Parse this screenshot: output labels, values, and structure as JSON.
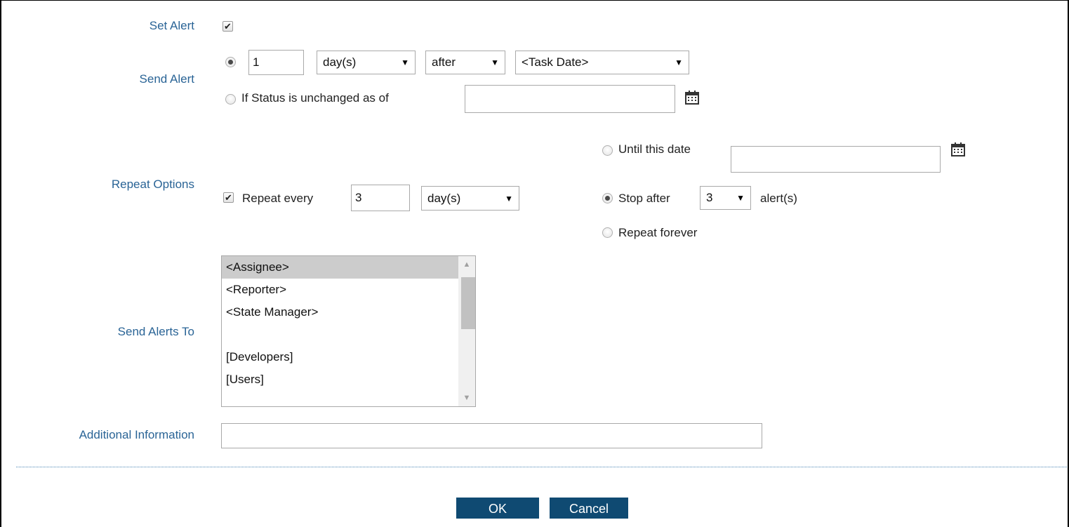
{
  "labels": {
    "set_alert": "Set Alert",
    "send_alert": "Send Alert",
    "repeat_options": "Repeat Options",
    "send_alerts_to": "Send Alerts To",
    "additional_information": "Additional Information"
  },
  "set_alert": {
    "checked": true
  },
  "send_alert": {
    "option_relative": {
      "selected": true,
      "amount": "1",
      "unit": "day(s)",
      "relation": "after",
      "reference": "<Task Date>"
    },
    "option_status": {
      "selected": false,
      "label": "If Status is unchanged as of",
      "date_value": ""
    }
  },
  "repeat": {
    "checked": true,
    "label": "Repeat every",
    "amount": "3",
    "unit": "day(s)",
    "until": {
      "selected": false,
      "label": "Until this date",
      "date_value": ""
    },
    "stop_after": {
      "selected": true,
      "label": "Stop after",
      "count": "3",
      "suffix": "alert(s)"
    },
    "forever": {
      "selected": false,
      "label": "Repeat forever"
    }
  },
  "recipients": {
    "options": [
      "<Assignee>",
      "<Reporter>",
      "<State Manager>",
      "",
      "[Developers]",
      "[Users]"
    ],
    "selected_index": 0
  },
  "additional_info": {
    "value": ""
  },
  "buttons": {
    "ok": "OK",
    "cancel": "Cancel"
  },
  "icons": {
    "calendar": "calendar-icon",
    "checkmark": "✔",
    "arrow": "▼"
  },
  "colors": {
    "label": "#2a6496",
    "button_bg": "#0f4a72",
    "divider": "#4a86b4"
  }
}
